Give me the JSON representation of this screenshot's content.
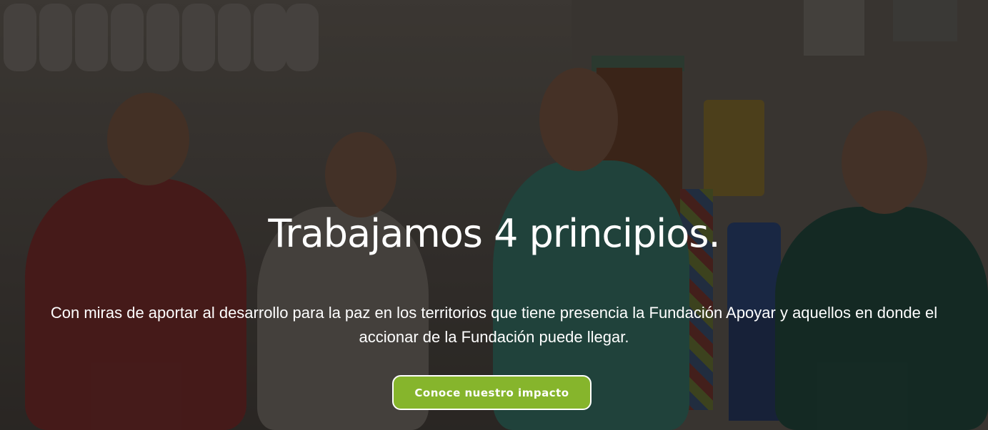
{
  "hero": {
    "title": "Trabajamos 4 principios.",
    "subtitle": "Con miras de aportar al desarrollo para la paz en los territorios que tiene presencia la Fundación Apoyar y aquellos en donde el accionar de la Fundación puede llegar.",
    "cta_label": "Conoce nuestro impacto"
  },
  "colors": {
    "cta_background": "#86b52c",
    "cta_border": "#ffffff",
    "text": "#ffffff"
  }
}
